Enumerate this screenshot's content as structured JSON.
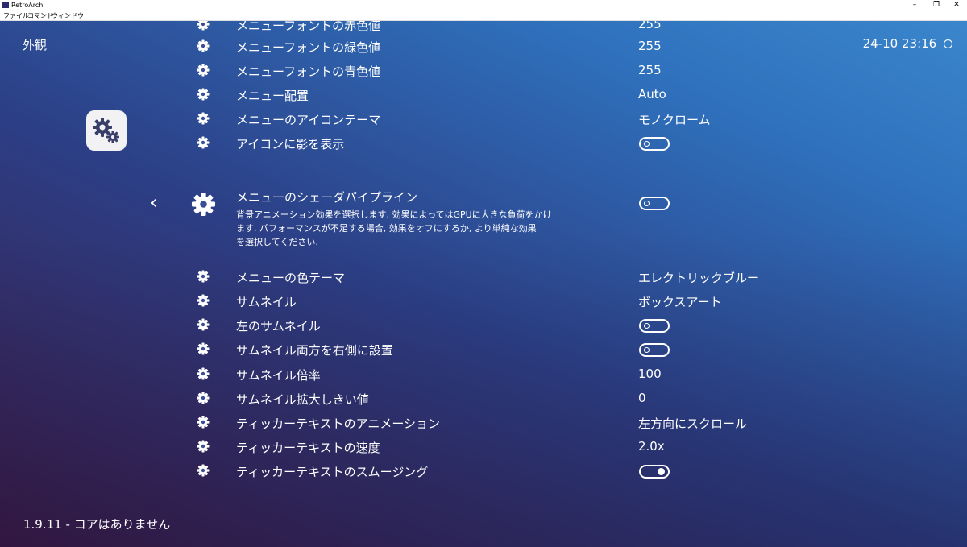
{
  "window": {
    "title": "RetroArch",
    "controls": {
      "minimize": "–",
      "restore": "❐",
      "close": "✕"
    }
  },
  "menubar": [
    "ファイル",
    "コマンド",
    "ウィンドウ"
  ],
  "header": {
    "section_title": "外観",
    "clock": "24-10 23:16"
  },
  "footer": {
    "version": "1.9.11 - コアはありません"
  },
  "rows_top": [
    {
      "label": "メニューフォントの赤色値",
      "value": "255"
    },
    {
      "label": "メニューフォントの緑色値",
      "value": "255"
    },
    {
      "label": "メニューフォントの青色値",
      "value": "255"
    },
    {
      "label": "メニュー配置",
      "value": "Auto"
    },
    {
      "label": "メニューのアイコンテーマ",
      "value": "モノクローム"
    },
    {
      "label": "アイコンに影を表示",
      "toggle": "off"
    }
  ],
  "selected": {
    "label": "メニューのシェーダパイプライン",
    "description_lines": [
      "背景アニメーション効果を選択します. 効果によってはGPUに大きな負荷をかけ",
      "ます. パフォーマンスが不足する場合, 効果をオフにするか, より単純な効果",
      "を選択してください."
    ],
    "toggle": "off"
  },
  "rows_bottom": [
    {
      "label": "メニューの色テーマ",
      "value": "エレクトリックブルー"
    },
    {
      "label": "サムネイル",
      "value": "ボックスアート"
    },
    {
      "label": "左のサムネイル",
      "toggle": "off"
    },
    {
      "label": "サムネイル両方を右側に設置",
      "toggle": "off"
    },
    {
      "label": "サムネイル倍率",
      "value": "100"
    },
    {
      "label": "サムネイル拡大しきい値",
      "value": "0"
    },
    {
      "label": "ティッカーテキストのアニメーション",
      "value": "左方向にスクロール"
    },
    {
      "label": "ティッカーテキストの速度",
      "value": "2.0x"
    },
    {
      "label": "ティッカーテキストのスムージング",
      "toggle": "on"
    }
  ],
  "icons": {
    "row": "gear-icon",
    "settings_tile": "settings-gears-icon",
    "back": "chevron-left-icon",
    "clock": "clock-icon"
  },
  "colors": {
    "text": "#ffffff",
    "tile": "#f2f2f5",
    "tile_icon": "#3a3f6a"
  }
}
